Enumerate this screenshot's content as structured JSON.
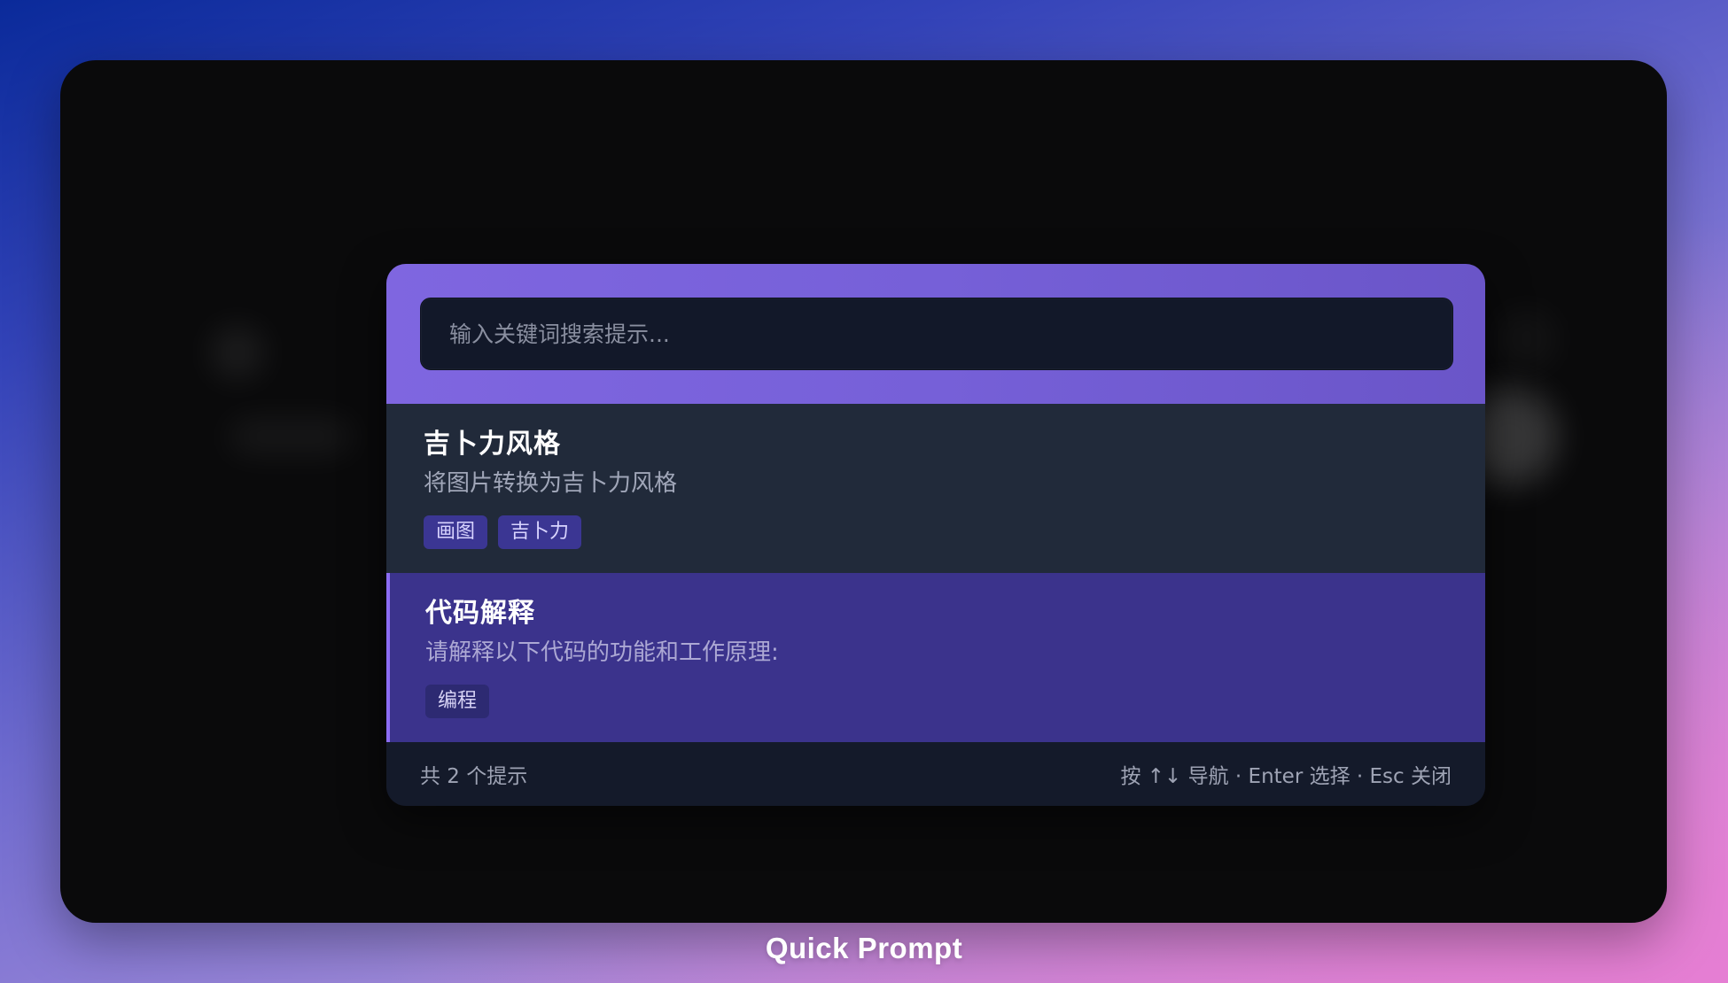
{
  "search": {
    "placeholder": "输入关键词搜索提示...",
    "value": ""
  },
  "prompts": [
    {
      "title": "吉卜力风格",
      "description": "将图片转换为吉卜力风格",
      "tags": [
        "画图",
        "吉卜力"
      ],
      "selected": false
    },
    {
      "title": "代码解释",
      "description": "请解释以下代码的功能和工作原理:",
      "tags": [
        "编程"
      ],
      "selected": true
    }
  ],
  "footer": {
    "count_label": "共 2 个提示",
    "hint": "按 ↑↓ 导航 · Enter 选择 · Esc 关闭"
  },
  "caption": "Quick Prompt",
  "colors": {
    "header_accent": "#7f66e0",
    "selected_bg": "#3b338c",
    "selected_border": "#8b6cf3",
    "tag_bg": "#3b3693"
  }
}
